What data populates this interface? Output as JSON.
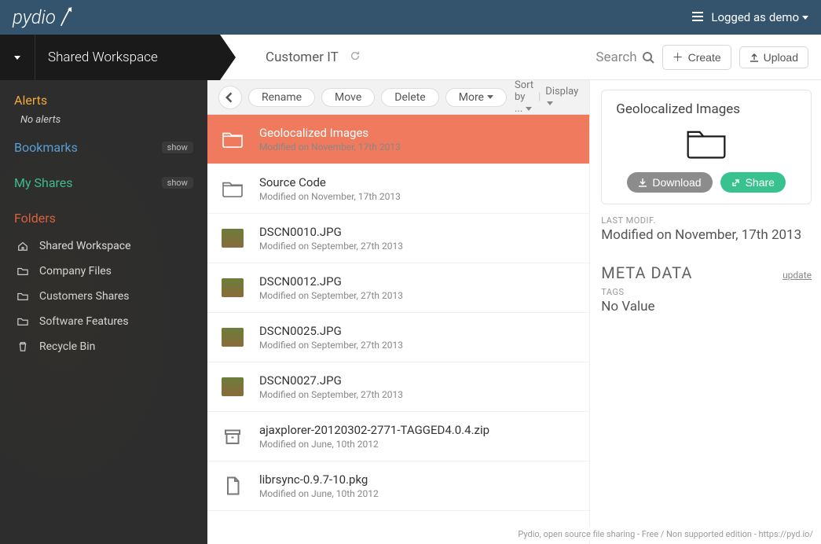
{
  "brand": "pydio",
  "user": {
    "prefix": "Logged as ",
    "name": "demo"
  },
  "workspace": "Shared Workspace",
  "breadcrumb": "Customer IT",
  "search_label": "Search",
  "actions": {
    "create": "Create",
    "upload": "Upload"
  },
  "sidebar": {
    "alerts": {
      "label": "Alerts",
      "sub": "No alerts"
    },
    "bookmarks": {
      "label": "Bookmarks",
      "badge": "show"
    },
    "shares": {
      "label": "My Shares",
      "badge": "show"
    },
    "folders": {
      "label": "Folders"
    },
    "tree": [
      {
        "icon": "home",
        "label": "Shared Workspace"
      },
      {
        "icon": "folder",
        "label": "Company Files"
      },
      {
        "icon": "folder",
        "label": "Customers Shares"
      },
      {
        "icon": "folder",
        "label": "Software Features"
      },
      {
        "icon": "trash",
        "label": "Recycle Bin"
      }
    ]
  },
  "toolbar": {
    "rename": "Rename",
    "move": "Move",
    "delete": "Delete",
    "more": "More",
    "sort": "Sort by ...",
    "display": "Display"
  },
  "files": [
    {
      "type": "folder",
      "name": "Geolocalized Images",
      "meta": "Modified on November, 17th 2013",
      "selected": true
    },
    {
      "type": "folder",
      "name": "Source Code",
      "meta": "Modified on November, 17th 2013"
    },
    {
      "type": "image",
      "name": "DSCN0010.JPG",
      "meta": "Modified on September, 27th 2013"
    },
    {
      "type": "image",
      "name": "DSCN0012.JPG",
      "meta": "Modified on September, 27th 2013"
    },
    {
      "type": "image",
      "name": "DSCN0025.JPG",
      "meta": "Modified on September, 27th 2013"
    },
    {
      "type": "image",
      "name": "DSCN0027.JPG",
      "meta": "Modified on September, 27th 2013"
    },
    {
      "type": "archive",
      "name": "ajaxplorer-20120302-2771-TAGGED4.0.4.zip",
      "meta": "Modified on June, 10th 2012"
    },
    {
      "type": "file",
      "name": "librsync-0.9.7-10.pkg",
      "meta": "Modified on June, 10th 2012"
    }
  ],
  "detail": {
    "title": "Geolocalized Images",
    "download": "Download",
    "share": "Share",
    "last_modif_label": "LAST MODIF.",
    "last_modif_value": "Modified on November, 17th 2013",
    "meta_header": "META DATA",
    "update": "update",
    "tags_label": "TAGS",
    "tags_value": "No Value"
  },
  "footer": "Pydio, open source file sharing - Free / Non supported edition - https://pyd.io/"
}
